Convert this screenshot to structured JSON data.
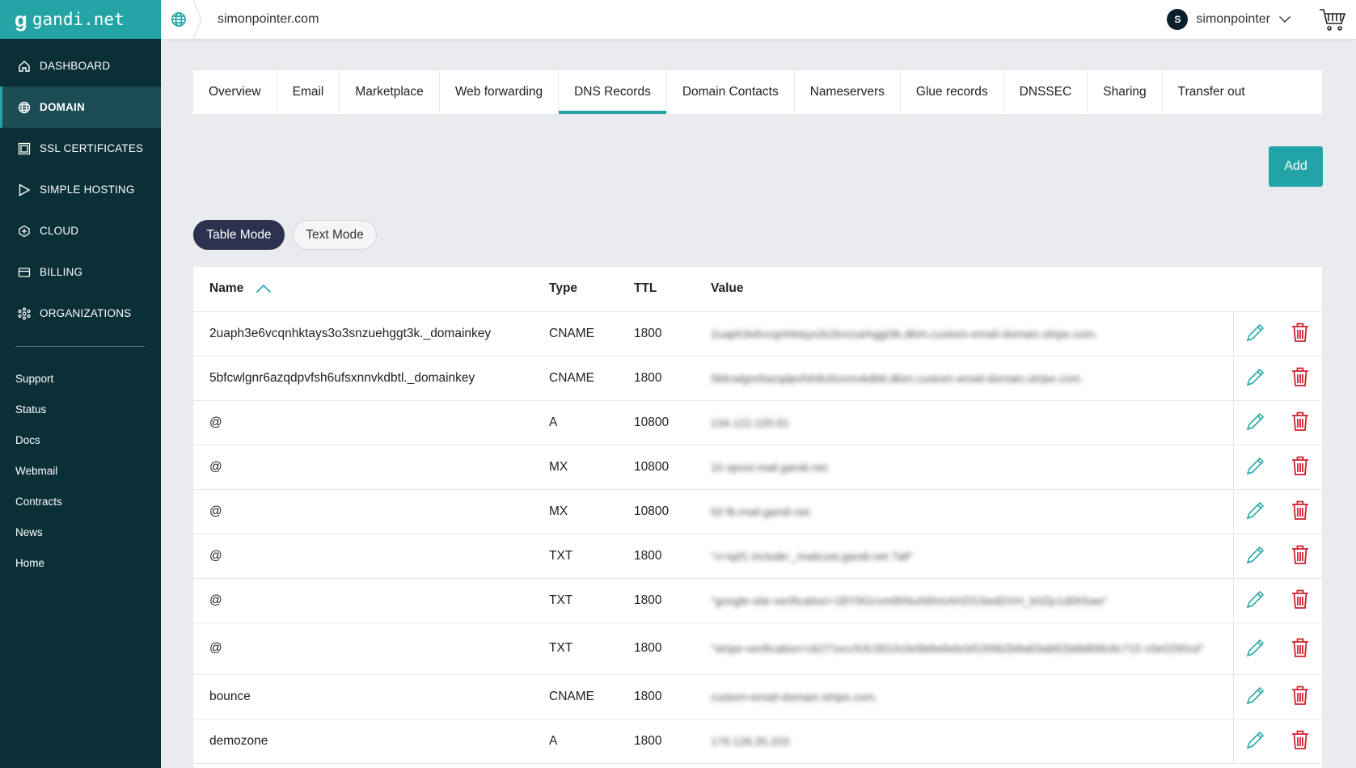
{
  "brand": {
    "logo_text": "gandi.net",
    "logo_mark": "g"
  },
  "sidebar": {
    "nav": [
      {
        "label": "DASHBOARD",
        "icon": "home-icon",
        "active": false
      },
      {
        "label": "DOMAIN",
        "icon": "globe-icon",
        "active": true
      },
      {
        "label": "SSL CERTIFICATES",
        "icon": "certificate-icon",
        "active": false
      },
      {
        "label": "SIMPLE HOSTING",
        "icon": "play-icon",
        "active": false
      },
      {
        "label": "CLOUD",
        "icon": "cloud-icon",
        "active": false
      },
      {
        "label": "BILLING",
        "icon": "card-icon",
        "active": false
      },
      {
        "label": "ORGANIZATIONS",
        "icon": "organizations-icon",
        "active": false
      }
    ],
    "links": [
      "Support",
      "Status",
      "Docs",
      "Webmail",
      "Contracts",
      "News",
      "Home"
    ]
  },
  "topbar": {
    "domain": "simonpointer.com",
    "user": {
      "initial": "S",
      "name": "simonpointer"
    }
  },
  "tabs": [
    {
      "label": "Overview",
      "active": false
    },
    {
      "label": "Email",
      "active": false
    },
    {
      "label": "Marketplace",
      "active": false
    },
    {
      "label": "Web forwarding",
      "active": false
    },
    {
      "label": "DNS Records",
      "active": true
    },
    {
      "label": "Domain Contacts",
      "active": false
    },
    {
      "label": "Nameservers",
      "active": false
    },
    {
      "label": "Glue records",
      "active": false
    },
    {
      "label": "DNSSEC",
      "active": false
    },
    {
      "label": "Sharing",
      "active": false
    },
    {
      "label": "Transfer out",
      "active": false
    }
  ],
  "add_label": "Add",
  "modes": {
    "table": "Table Mode",
    "text": "Text Mode"
  },
  "table": {
    "headers": {
      "name": "Name",
      "type": "Type",
      "ttl": "TTL",
      "value": "Value"
    },
    "rows": [
      {
        "name": "2uaph3e6vcqnhktays3o3snzuehggt3k._domainkey",
        "type": "CNAME",
        "ttl": "1800",
        "value": "2uaph3e6vcqnhktays3o3snzuehggt3k.dkim.custom-email-domain.stripe.com."
      },
      {
        "name": "5bfcwlgnr6azqdpvfsh6ufsxnnvkdbtl._domainkey",
        "type": "CNAME",
        "ttl": "1800",
        "value": "5bfcwlgnr6azqdpvfsh6ufsxnnvkdbtl.dkim.custom-email-domain.stripe.com."
      },
      {
        "name": "@",
        "type": "A",
        "ttl": "10800",
        "value": "134.122.100.61"
      },
      {
        "name": "@",
        "type": "MX",
        "ttl": "10800",
        "value": "10 spool.mail.gandi.net."
      },
      {
        "name": "@",
        "type": "MX",
        "ttl": "10800",
        "value": "50 fb.mail.gandi.net."
      },
      {
        "name": "@",
        "type": "TXT",
        "ttl": "1800",
        "value": "\"v=spf1 include:_mailcust.gandi.net ?all\""
      },
      {
        "name": "@",
        "type": "TXT",
        "ttl": "1800",
        "value": "\"google-site-verification=1BY9Gcvm9hNuh6hmAHZG3wdDXH_b0Zjc1d0h5aw\""
      },
      {
        "name": "@",
        "type": "TXT",
        "ttl": "1800",
        "value": "\"stripe-verification=cb271eccfcfc3910c0e9b6e6ebcb5269b2b8a63ab62b6b808c8c715 c0e0290cd\""
      },
      {
        "name": "bounce",
        "type": "CNAME",
        "ttl": "1800",
        "value": "custom-email-domain.stripe.com."
      },
      {
        "name": "demozone",
        "type": "A",
        "ttl": "1800",
        "value": "178.128.35.203"
      }
    ]
  },
  "colors": {
    "accent": "#25a4a6",
    "sidebar_bg": "#0a2f36",
    "active_mode": "#2c3150",
    "delete": "#d0202f",
    "edit": "#2aa9a6"
  }
}
